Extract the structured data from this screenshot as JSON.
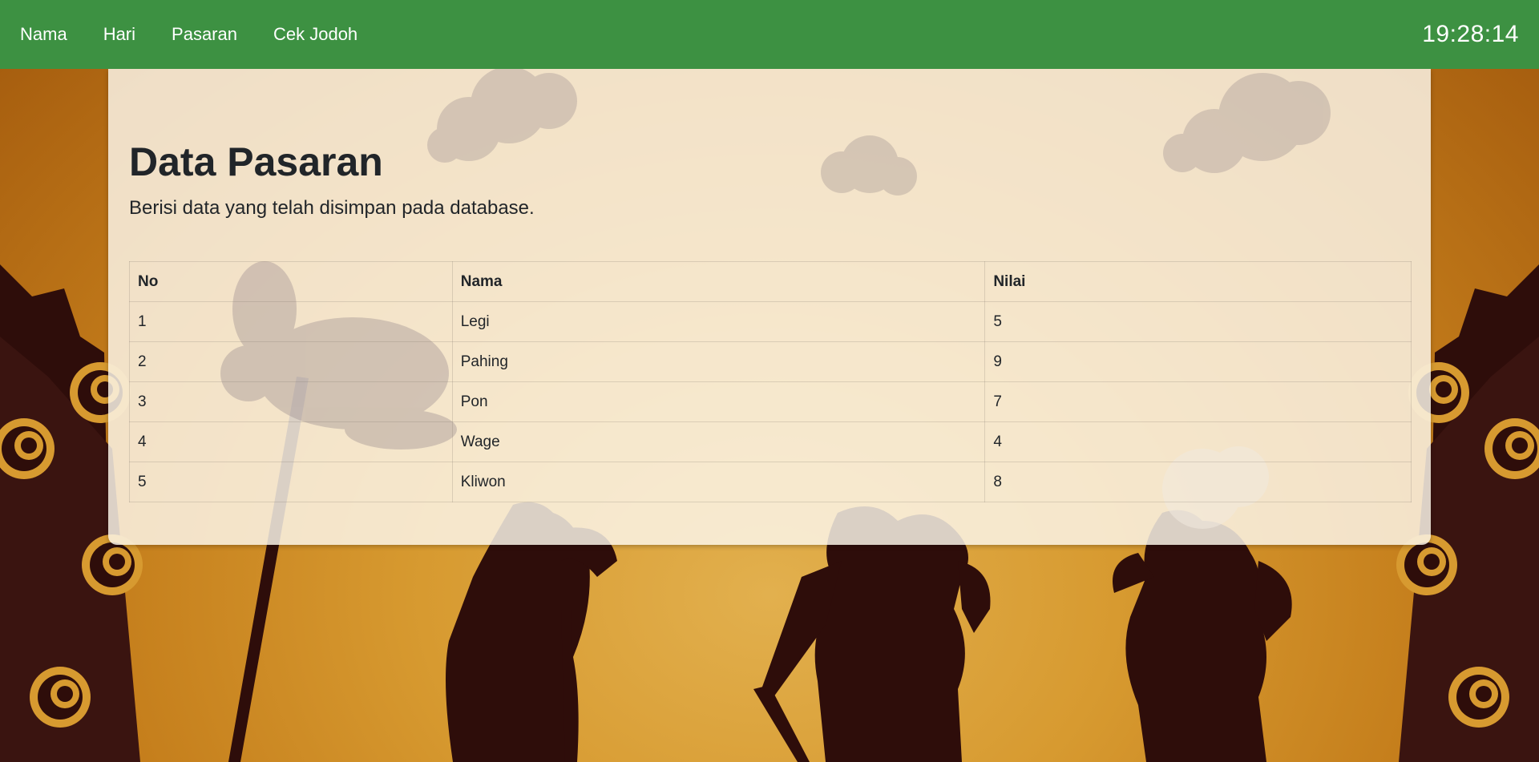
{
  "navbar": {
    "links": [
      {
        "label": "Nama"
      },
      {
        "label": "Hari"
      },
      {
        "label": "Pasaran"
      },
      {
        "label": "Cek Jodoh"
      }
    ],
    "clock": "19:28:14",
    "background_color": "#3d9142"
  },
  "page": {
    "title": "Data Pasaran",
    "subtitle": "Berisi data yang telah disimpan pada database."
  },
  "table": {
    "headers": [
      "No",
      "Nama",
      "Nilai"
    ],
    "rows": [
      [
        "1",
        "Legi",
        "5"
      ],
      [
        "2",
        "Pahing",
        "9"
      ],
      [
        "3",
        "Pon",
        "7"
      ],
      [
        "4",
        "Wage",
        "4"
      ],
      [
        "5",
        "Kliwon",
        "8"
      ]
    ]
  },
  "colors": {
    "accent": "#3d9142",
    "background_gold": "#d79a30",
    "silhouette": "#2e0d0a",
    "card": "#fcf5e9"
  }
}
